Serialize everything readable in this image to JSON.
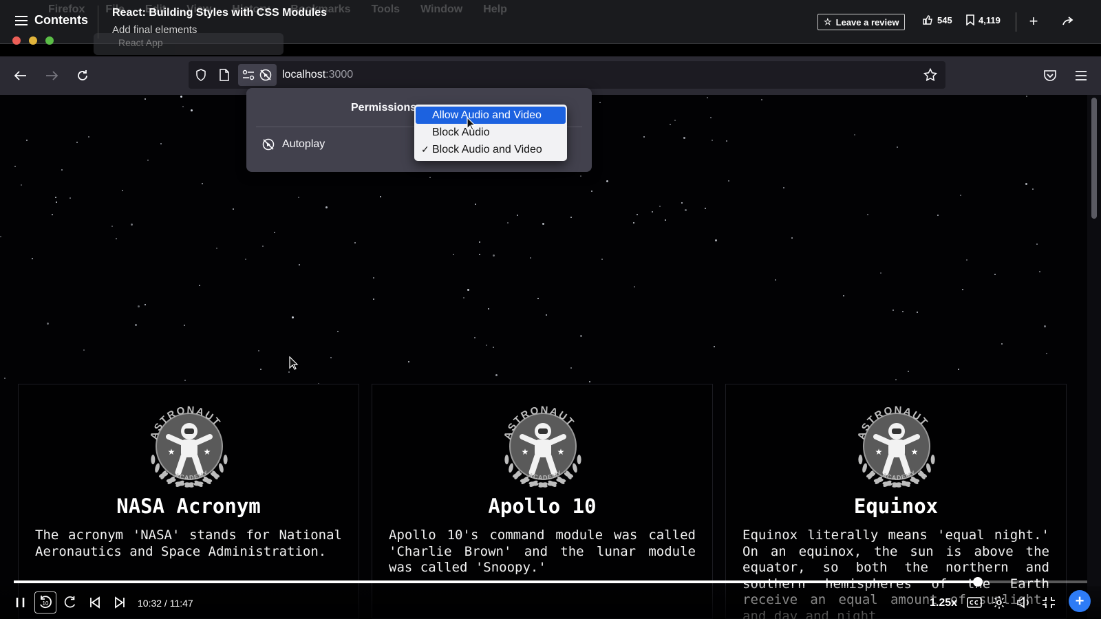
{
  "course": {
    "contents_label": "Contents",
    "title": "React: Building Styles with CSS Modules",
    "subtitle": "Add final elements",
    "review_label": "Leave a review",
    "likes": "545",
    "bookmarks": "4,119"
  },
  "mac": {
    "menu": [
      "Firefox",
      "File",
      "Edit",
      "View",
      "History",
      "Bookmarks",
      "Tools",
      "Window",
      "Help"
    ],
    "tab_title": "React App"
  },
  "browser": {
    "url_host": "localhost",
    "url_port": ":3000"
  },
  "permissions": {
    "title": "Permissions",
    "autoplay_label": "Autoplay",
    "options": [
      "Allow Audio and Video",
      "Block Audio",
      "Block Audio and Video"
    ],
    "highlighted": "Allow Audio and Video",
    "checked": "Block Audio and Video",
    "check_mark": "✓"
  },
  "cards": [
    {
      "title": "NASA Acronym",
      "text": "The acronym 'NASA' stands for National Aeronautics and Space Administration."
    },
    {
      "title": "Apollo 10",
      "text": "Apollo 10's command module was called 'Charlie Brown' and the lunar module was called 'Snoopy.'"
    },
    {
      "title": "Equinox",
      "text": "Equinox literally means 'equal night.' On an equinox, the sun is above the equator, so both the northern and southern hemispheres of the Earth receive an equal amount of sunlight, and day and night"
    }
  ],
  "logo": {
    "top_text": "ASTRONAUT",
    "bottom_text": "ACADEMY"
  },
  "player": {
    "time": "10:32 / 11:47",
    "speed": "1.25x",
    "progress": 0.898,
    "skip_seconds": "10"
  },
  "colors": {
    "accent": "#2e7cf6",
    "dropdown_highlight": "#1c62e0",
    "urlbar": "#1c1b22",
    "toolbar": "#2b2a33"
  }
}
